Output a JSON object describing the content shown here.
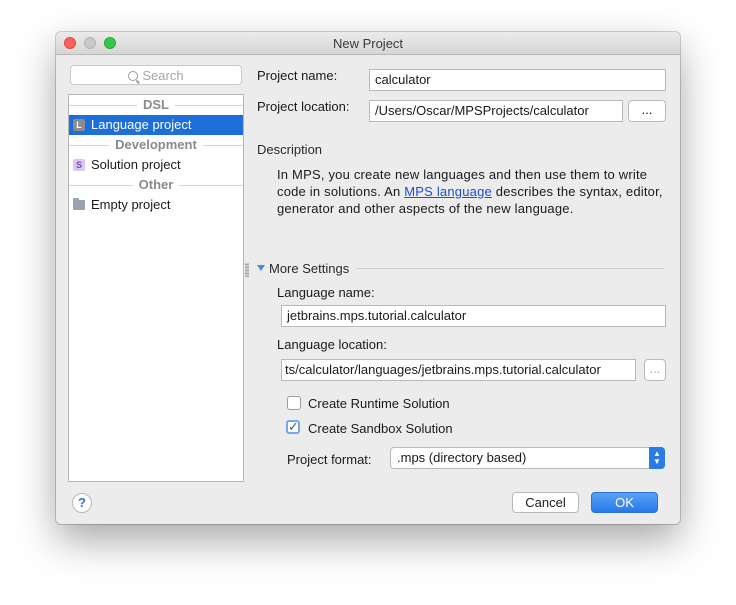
{
  "window": {
    "title": "New Project"
  },
  "search": {
    "placeholder": "Search"
  },
  "tree": {
    "groups": [
      {
        "label": "DSL",
        "items": [
          {
            "label": "Language project",
            "icon": "L",
            "selected": true
          }
        ]
      },
      {
        "label": "Development",
        "items": [
          {
            "label": "Solution project",
            "icon": "S"
          }
        ]
      },
      {
        "label": "Other",
        "items": [
          {
            "label": "Empty project",
            "icon": "folder"
          }
        ]
      }
    ]
  },
  "form": {
    "project_name_label": "Project name:",
    "project_name_value": "calculator",
    "project_location_label": "Project location:",
    "project_location_value": "/Users/Oscar/MPSProjects/calculator",
    "browse_label": "..."
  },
  "description": {
    "heading": "Description",
    "text_before": "In MPS, you create new languages and then use them to write code in solutions. An ",
    "link": "MPS language",
    "text_after": " describes the syntax, editor, generator and other aspects of the new language."
  },
  "more_settings": {
    "heading": "More Settings",
    "language_name_label": "Language name:",
    "language_name_value": "jetbrains.mps.tutorial.calculator",
    "language_location_label": "Language location:",
    "language_location_value": "ts/calculator/languages/jetbrains.mps.tutorial.calculator",
    "browse_label": "...",
    "create_runtime_label": "Create Runtime Solution",
    "create_runtime_checked": false,
    "create_sandbox_label": "Create Sandbox Solution",
    "create_sandbox_checked": true,
    "project_format_label": "Project format:",
    "project_format_value": ".mps (directory based)"
  },
  "footer": {
    "help_label": "?",
    "cancel_label": "Cancel",
    "ok_label": "OK"
  },
  "colors": {
    "accent": "#1c6fd8",
    "ok_button": "#2779ea",
    "link": "#1a4fd0"
  }
}
